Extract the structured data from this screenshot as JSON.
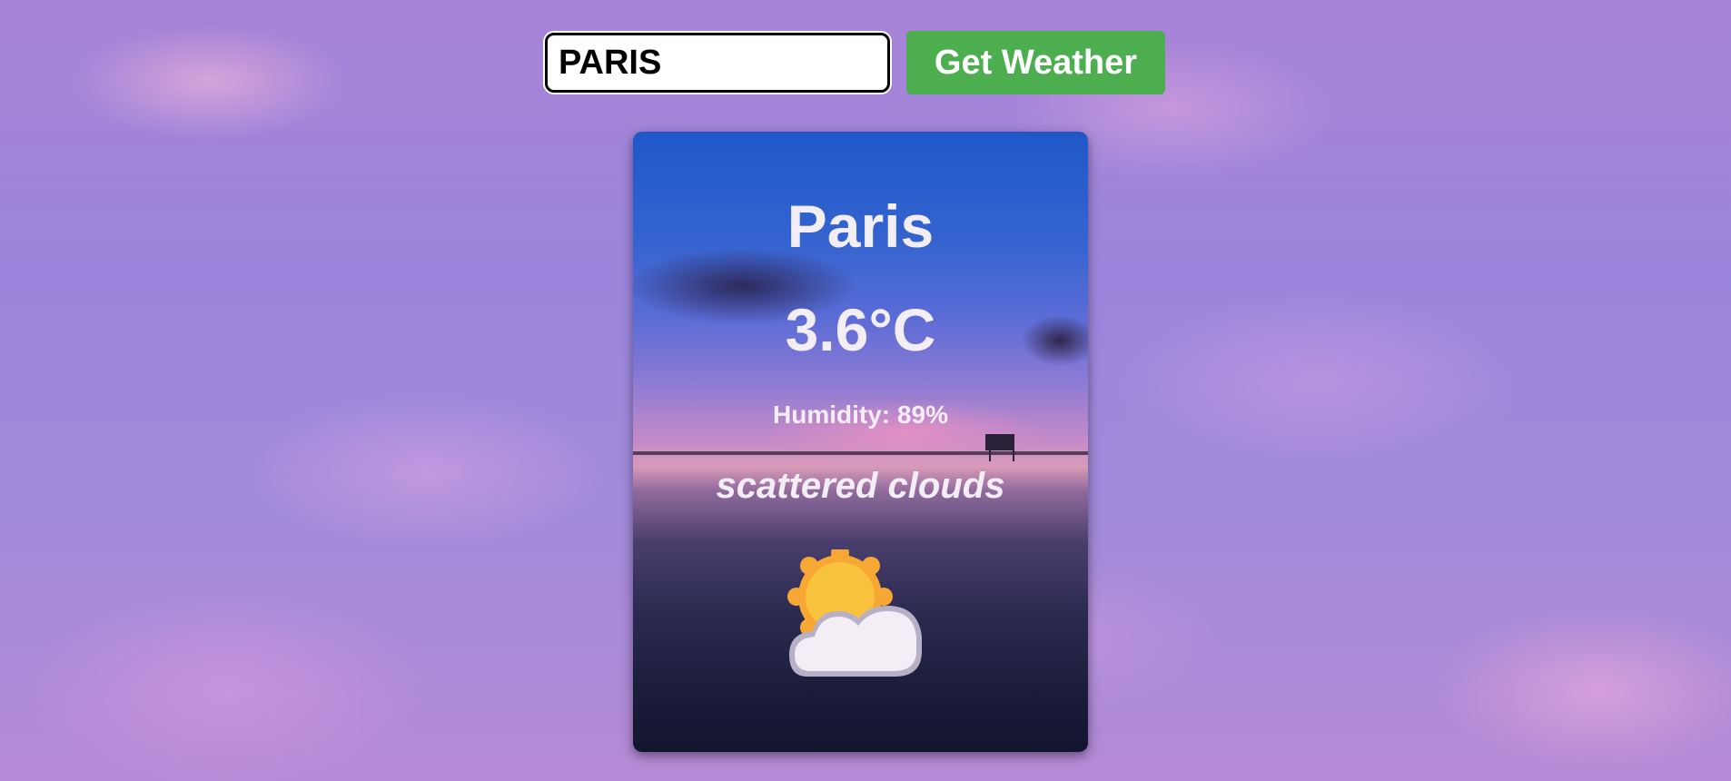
{
  "search": {
    "value": "PARIS",
    "button_label": "Get Weather"
  },
  "weather": {
    "city": "Paris",
    "temperature": "3.6°C",
    "humidity_label": "Humidity:",
    "humidity_value": "89%",
    "description": "scattered clouds",
    "icon": "partly-cloudy-icon"
  },
  "colors": {
    "button": "#4cae4f",
    "text": "#f3eef6"
  }
}
